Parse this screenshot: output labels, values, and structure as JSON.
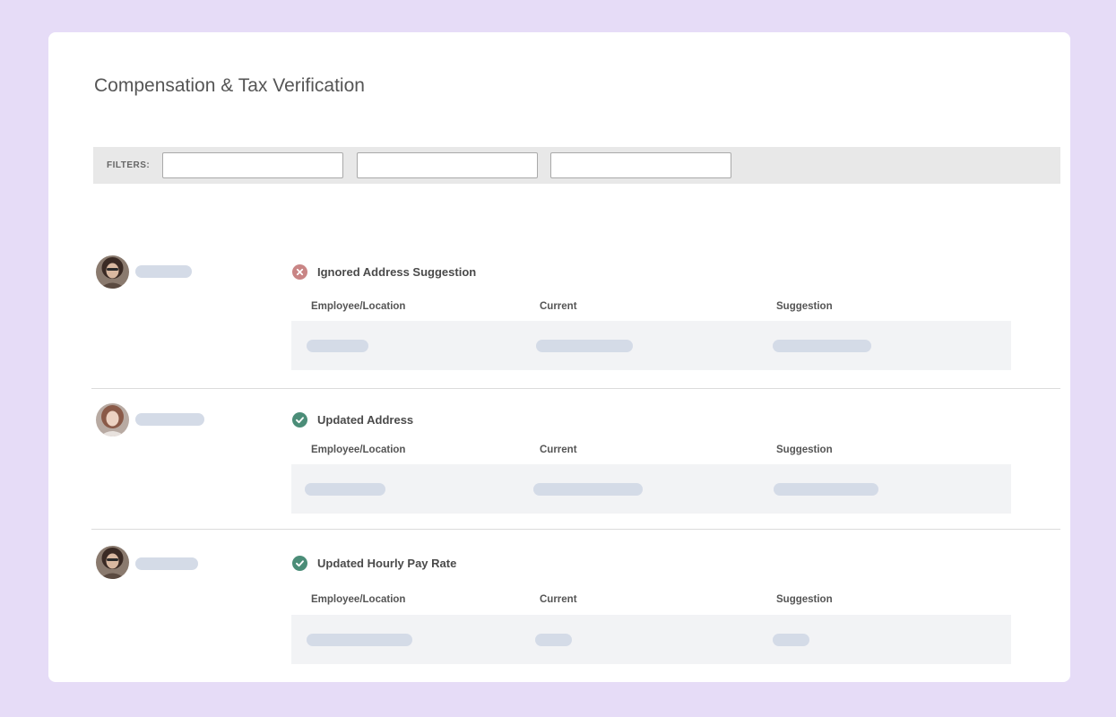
{
  "page": {
    "title": "Compensation & Tax Verification"
  },
  "filters": {
    "label": "FILTERS:",
    "inputs": [
      {
        "value": "",
        "placeholder": ""
      },
      {
        "value": "",
        "placeholder": ""
      },
      {
        "value": "",
        "placeholder": ""
      }
    ]
  },
  "table": {
    "columns": [
      "Employee/Location",
      "Current",
      "Suggestion"
    ]
  },
  "items": [
    {
      "status": "ignored",
      "status_icon": "x-circle-icon",
      "title": "Ignored Address Suggestion"
    },
    {
      "status": "updated",
      "status_icon": "check-circle-icon",
      "title": "Updated Address"
    },
    {
      "status": "updated",
      "status_icon": "check-circle-icon",
      "title": "Updated Hourly Pay Rate"
    }
  ],
  "colors": {
    "background": "#e6dcf7",
    "ignored": "#c98585",
    "updated": "#4b8d78",
    "placeholder_pill": "#d4dbe7"
  }
}
